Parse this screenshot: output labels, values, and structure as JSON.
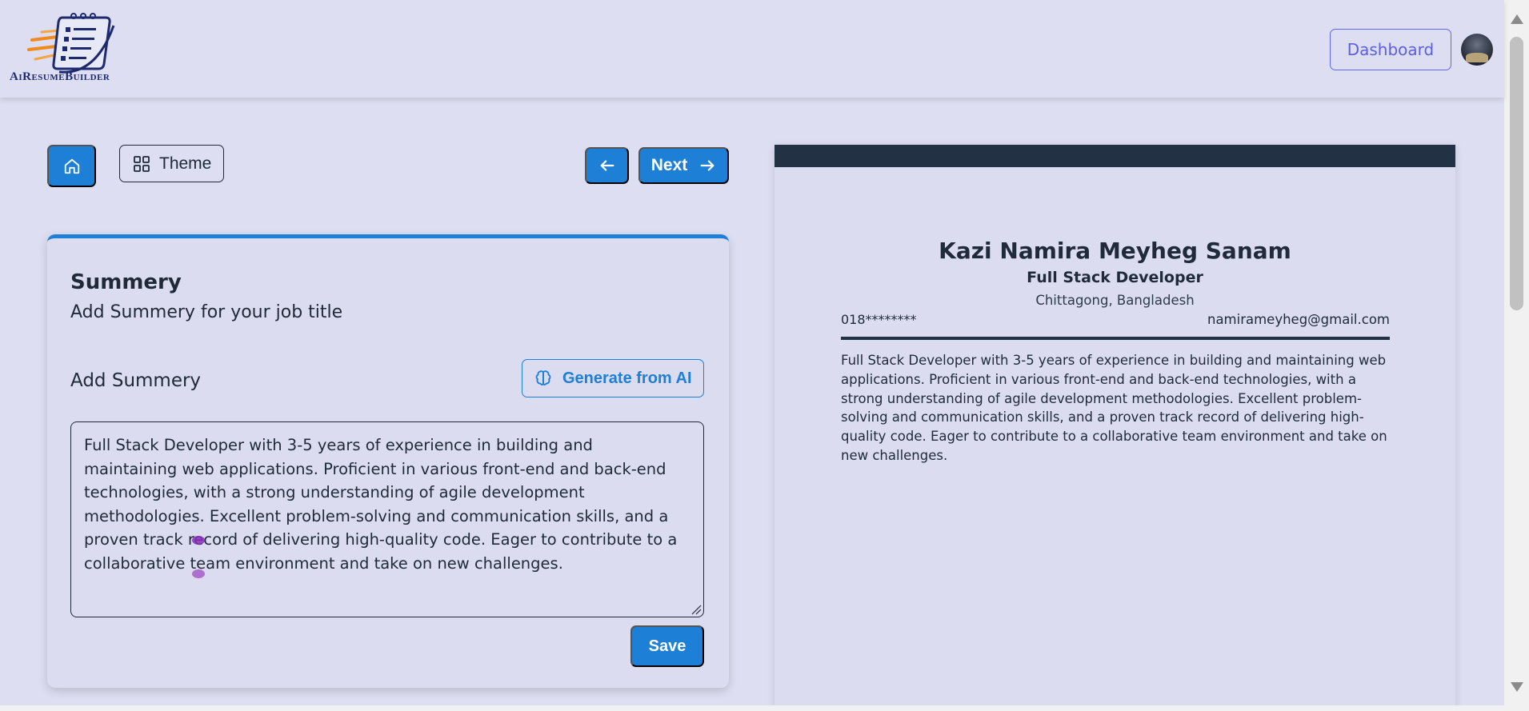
{
  "header": {
    "logo_text": "AiResumeBuilder",
    "dashboard_label": "Dashboard",
    "avatar_icon": "user-avatar"
  },
  "toolbar": {
    "home_icon": "home-icon",
    "theme_label": "Theme",
    "prev_icon": "arrow-left-icon",
    "next_label": "Next",
    "next_icon": "arrow-right-icon"
  },
  "form": {
    "title": "Summery",
    "subtitle": "Add Summery for your job title",
    "field_label": "Add Summery",
    "generate_label": "Generate from AI",
    "generate_icon": "brain-icon",
    "summary_value": "Full Stack Developer with 3-5 years of experience in building and maintaining web applications. Proficient in various front-end and back-end technologies, with a strong understanding of agile development methodologies. Excellent problem-solving and communication skills, and a proven track record of delivering high-quality code. Eager to contribute to a collaborative team environment and take on new challenges.",
    "save_label": "Save"
  },
  "preview": {
    "name": "Kazi Namira Meyheg Sanam",
    "job_title": "Full Stack Developer",
    "location": "Chittagong, Bangladesh",
    "phone": "018********",
    "email": "namirameyheg@gmail.com",
    "summary": "Full Stack Developer with 3-5 years of experience in building and maintaining web applications. Proficient in various front-end and back-end technologies, with a strong understanding of agile development methodologies. Excellent problem-solving and communication skills, and a proven track record of delivering high-quality code. Eager to contribute to a collaborative team environment and take on new challenges."
  },
  "colors": {
    "background": "#dddef2",
    "primary": "#1d7fd6",
    "dashboard_accent": "#5b5fe0",
    "resume_theme": "#223143"
  }
}
